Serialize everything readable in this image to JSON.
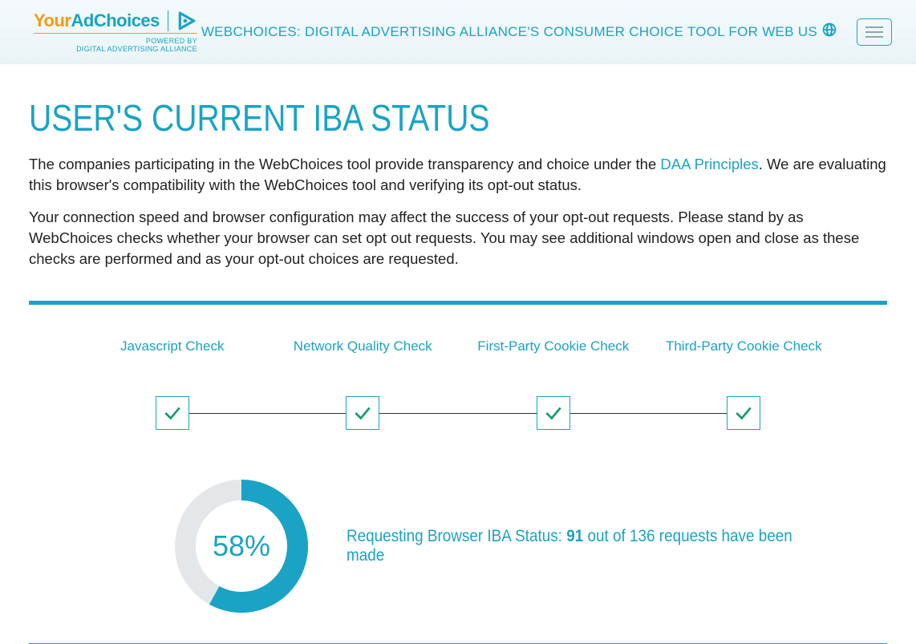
{
  "header": {
    "logo_your": "Your",
    "logo_ad": "Ad",
    "logo_choices": "Choices",
    "logo_subtitle": "POWERED BY\nDIGITAL ADVERTISING ALLIANCE",
    "title": "WEBCHOICES: DIGITAL ADVERTISING ALLIANCE'S CONSUMER CHOICE TOOL FOR WEB US"
  },
  "page": {
    "title": "USER'S CURRENT IBA STATUS",
    "para1_a": "The companies participating in the WebChoices tool provide transparency and choice under the ",
    "para1_link": "DAA Principles",
    "para1_b": ". We are evaluating this browser's compatibility with the WebChoices tool and verifying its opt-out status.",
    "para2": "Your connection speed and browser configuration may affect the success of your opt-out requests. Please stand by as WebChoices checks whether your browser can set opt out requests. You may see additional windows open and close as these checks are performed and as your opt-out choices are requested."
  },
  "checks": {
    "items": [
      {
        "label": "Javascript Check"
      },
      {
        "label": "Network Quality Check"
      },
      {
        "label": "First-Party Cookie Check"
      },
      {
        "label": "Third-Party Cookie Check"
      }
    ]
  },
  "progress": {
    "percent": 58,
    "percent_label": "58%",
    "text_a": "Requesting Browser IBA Status: ",
    "completed": "91",
    "text_b": " out of 136 requests have been made"
  },
  "colors": {
    "accent": "#1aa3c4",
    "orange": "#f39c12",
    "check_green": "#1a9b6c"
  }
}
